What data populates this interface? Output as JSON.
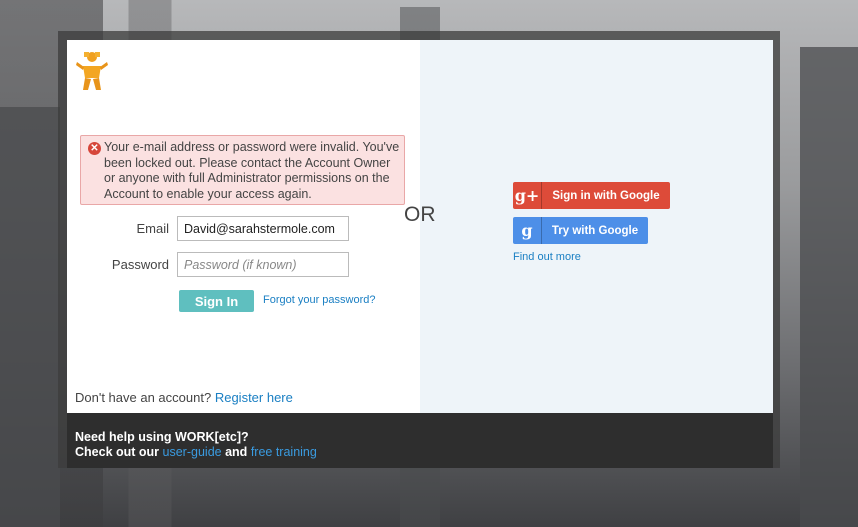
{
  "error": {
    "message": "Your e-mail address or password were invalid. You've been locked out. Please contact the Account Owner or anyone with full Administrator permissions on the Account to enable your access again."
  },
  "form": {
    "email_label": "Email",
    "email_value": "David@sarahstermole.com",
    "password_label": "Password",
    "password_placeholder": "Password (if known)",
    "signin_label": "Sign In",
    "forgot_label": "Forgot your password?"
  },
  "register": {
    "prompt": "Don't have an account?",
    "link": "Register here"
  },
  "divider": {
    "or": "OR"
  },
  "google": {
    "signin_label": "Sign in with Google",
    "try_label": "Try with Google",
    "find_out": "Find out more",
    "colors": {
      "gplus": "#dd4b39",
      "try": "#4d8fe8"
    }
  },
  "footer": {
    "line1": "Need help using WORK[etc]?",
    "line2_prefix": "Check out our",
    "user_guide": "user-guide",
    "and": "and",
    "free_training": "free training"
  },
  "colors": {
    "accent": "#5fbfbf",
    "link": "#1a7fc3"
  }
}
